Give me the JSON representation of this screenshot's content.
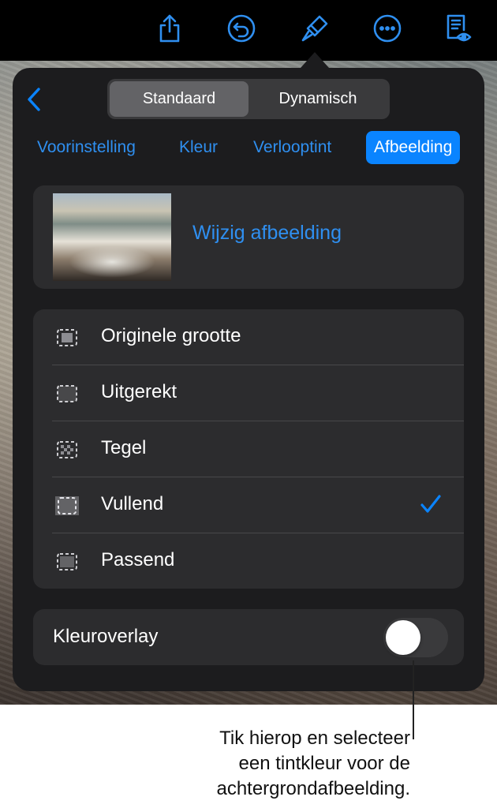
{
  "toolbar": {
    "icons": [
      "share-icon",
      "undo-icon",
      "paintbrush-icon",
      "more-icon",
      "reader-view-icon"
    ],
    "accent": "#2f8ff0"
  },
  "popover": {
    "segments": {
      "standard": "Standaard",
      "dynamic": "Dynamisch",
      "selected": "Standaard"
    },
    "tabs": [
      {
        "label": "Voorinstelling"
      },
      {
        "label": "Kleur"
      },
      {
        "label": "Verlooptint"
      },
      {
        "label": "Afbeelding"
      }
    ],
    "selected_tab": "Afbeelding",
    "change_image_label": "Wijzig afbeelding",
    "options": [
      {
        "label": "Originele grootte",
        "icon": "original-size-icon"
      },
      {
        "label": "Uitgerekt",
        "icon": "stretch-icon"
      },
      {
        "label": "Tegel",
        "icon": "tile-icon"
      },
      {
        "label": "Vullend",
        "icon": "fill-icon"
      },
      {
        "label": "Passend",
        "icon": "fit-icon"
      }
    ],
    "selected_option": "Vullend",
    "color_overlay": {
      "label": "Kleuroverlay",
      "on": false
    }
  },
  "callout": {
    "lines": [
      "Tik hierop en selecteer",
      "een tintkleur voor de",
      "achtergrondafbeelding."
    ]
  },
  "colors": {
    "accent": "#0a84ff",
    "popover_bg": "#1c1c1e",
    "card_bg": "#2c2c2e"
  }
}
